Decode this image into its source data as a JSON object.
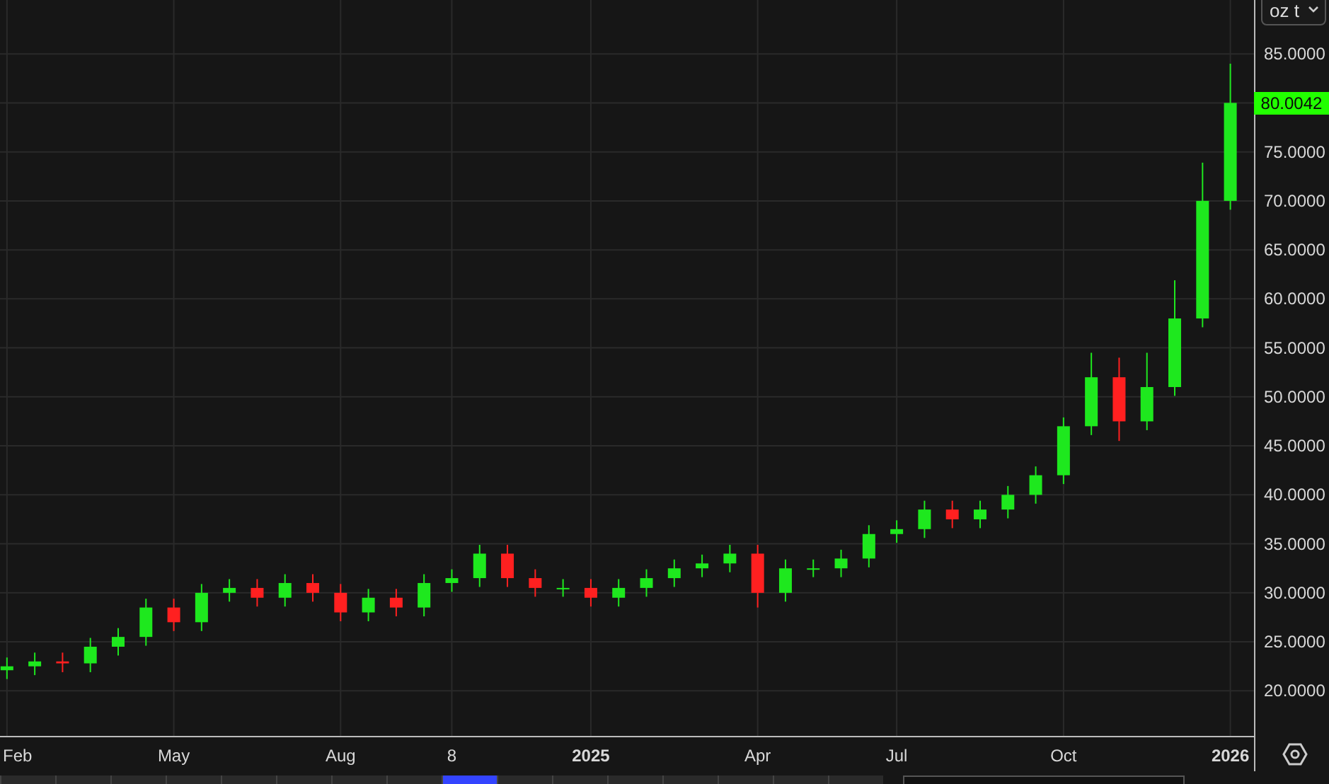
{
  "unit_select": {
    "value": "oz t"
  },
  "chart": {
    "price_label": "80.0042",
    "chart_data": {
      "type": "candlestick",
      "categories": [
        "Feb",
        null,
        null,
        null,
        null,
        null,
        "May",
        null,
        null,
        null,
        null,
        null,
        "Aug",
        null,
        null,
        null,
        "8",
        null,
        null,
        null,
        null,
        "2025",
        null,
        null,
        null,
        null,
        null,
        "Apr",
        null,
        null,
        null,
        null,
        "Jul",
        null,
        null,
        null,
        null,
        null,
        "Oct",
        null,
        null,
        null,
        null,
        null,
        "2026"
      ],
      "ohlc": [
        [
          22.1,
          23.4,
          21.2,
          22.5
        ],
        [
          22.5,
          23.9,
          21.6,
          23
        ],
        [
          23,
          23.9,
          21.9,
          22.8
        ],
        [
          22.8,
          25.4,
          21.9,
          24.5
        ],
        [
          24.5,
          26.4,
          23.6,
          25.5
        ],
        [
          25.5,
          29.4,
          24.6,
          28.5
        ],
        [
          28.5,
          29.4,
          26.1,
          27
        ],
        [
          27,
          30.9,
          26.1,
          30
        ],
        [
          30,
          31.4,
          29.1,
          30.5
        ],
        [
          30.5,
          31.4,
          28.6,
          29.5
        ],
        [
          29.5,
          31.9,
          28.6,
          31
        ],
        [
          31,
          31.9,
          29.1,
          30
        ],
        [
          30,
          30.9,
          27.1,
          28
        ],
        [
          28,
          30.4,
          27.1,
          29.5
        ],
        [
          29.5,
          30.4,
          27.6,
          28.5
        ],
        [
          28.5,
          31.9,
          27.6,
          31
        ],
        [
          31,
          32.4,
          30.1,
          31.5
        ],
        [
          31.5,
          34.9,
          30.6,
          34
        ],
        [
          34,
          34.9,
          30.6,
          31.5
        ],
        [
          31.5,
          32.4,
          29.6,
          30.5
        ],
        [
          30.5,
          31.4,
          29.6,
          30.5
        ],
        [
          30.5,
          31.4,
          28.6,
          29.5
        ],
        [
          29.5,
          31.4,
          28.6,
          30.5
        ],
        [
          30.5,
          32.4,
          29.6,
          31.5
        ],
        [
          31.5,
          33.4,
          30.6,
          32.5
        ],
        [
          32.5,
          33.9,
          31.6,
          33
        ],
        [
          33,
          34.9,
          32.1,
          34
        ],
        [
          34,
          34.9,
          28.5,
          30
        ],
        [
          30,
          33.4,
          29.1,
          32.5
        ],
        [
          32.5,
          33.4,
          31.6,
          32.5
        ],
        [
          32.5,
          34.4,
          31.6,
          33.5
        ],
        [
          33.5,
          36.9,
          32.6,
          36
        ],
        [
          36,
          37.4,
          35.1,
          36.5
        ],
        [
          36.5,
          39.4,
          35.6,
          38.5
        ],
        [
          38.5,
          39.4,
          36.6,
          37.5
        ],
        [
          37.5,
          39.4,
          36.6,
          38.5
        ],
        [
          38.5,
          40.9,
          37.6,
          40
        ],
        [
          40,
          42.9,
          39.1,
          42
        ],
        [
          42,
          47.9,
          41.1,
          47
        ],
        [
          47,
          54.5,
          46.1,
          52
        ],
        [
          52,
          54,
          45.5,
          47.5
        ],
        [
          47.5,
          54.5,
          46.6,
          51
        ],
        [
          51,
          61.9,
          50.1,
          58
        ],
        [
          58,
          73.9,
          57.1,
          70
        ],
        [
          70,
          84,
          69.1,
          80
        ]
      ],
      "ylim": [
        15.4,
        90.5
      ],
      "grid": true,
      "yticks": [
        {
          "value": 20,
          "label": "20.0000"
        },
        {
          "value": 25,
          "label": "25.0000"
        },
        {
          "value": 30,
          "label": "30.0000"
        },
        {
          "value": 35,
          "label": "35.0000"
        },
        {
          "value": 40,
          "label": "40.0000"
        },
        {
          "value": 45,
          "label": "45.0000"
        },
        {
          "value": 50,
          "label": "50.0000"
        },
        {
          "value": 55,
          "label": "55.0000"
        },
        {
          "value": 60,
          "label": "60.0000"
        },
        {
          "value": 65,
          "label": "65.0000"
        },
        {
          "value": 70,
          "label": "70.0000"
        },
        {
          "value": 75,
          "label": "75.0000"
        },
        {
          "value": 85,
          "label": "85.0000"
        }
      ]
    }
  },
  "bottom_tabs": [
    {
      "selected": false
    },
    {
      "selected": false
    },
    {
      "selected": false
    },
    {
      "selected": false
    },
    {
      "selected": false
    },
    {
      "selected": false
    },
    {
      "selected": false
    },
    {
      "selected": false
    },
    {
      "selected": true
    },
    {
      "selected": false
    },
    {
      "selected": false
    },
    {
      "selected": false
    },
    {
      "selected": false
    },
    {
      "selected": false
    },
    {
      "selected": false
    },
    {
      "selected": false
    }
  ]
}
